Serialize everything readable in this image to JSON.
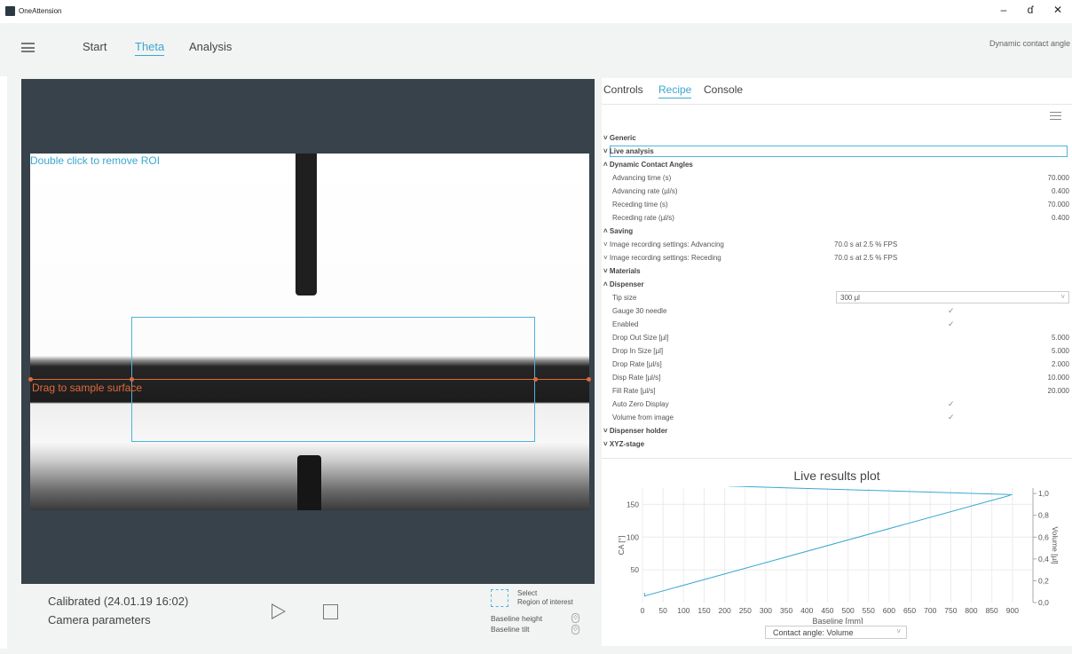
{
  "app": {
    "title": "OneAttension"
  },
  "window_controls": {
    "minimize": "–",
    "maximize": "ɗ",
    "close": "✕"
  },
  "nav": {
    "tabs": [
      "Start",
      "Theta",
      "Analysis"
    ],
    "active": "Theta",
    "mode_label": "Dynamic contact angle"
  },
  "camera": {
    "roi_hint": "Double click to remove ROI",
    "baseline_hint": "Drag to sample surface",
    "calibration": "Calibrated (24.01.19 16:02)",
    "camera_parameters": "Camera parameters",
    "roi_select_line1": "Select",
    "roi_select_line2": "Region of interest",
    "baseline_height": "Baseline height",
    "baseline_tilt": "Baseline tilt"
  },
  "panel": {
    "tabs": [
      "Controls",
      "Recipe",
      "Console"
    ],
    "active": "Recipe",
    "recipe": {
      "generic": "Generic",
      "live_analysis": "Live analysis",
      "dca": "Dynamic Contact Angles",
      "advancing_time_label": "Advancing time (s)",
      "advancing_time": "70.000",
      "advancing_rate_label": "Advancing rate (µl/s)",
      "advancing_rate": "0.400",
      "receding_time_label": "Receding time (s)",
      "receding_time": "70.000",
      "receding_rate_label": "Receding rate (µl/s)",
      "receding_rate": "0.400",
      "saving": "Saving",
      "img_adv_label": "Image recording settings: Advancing",
      "img_adv": "70.0 s at 2.5 % FPS",
      "img_rec_label": "Image recording settings: Receding",
      "img_rec": "70.0 s at 2.5 % FPS",
      "materials": "Materials",
      "dispenser": "Dispenser",
      "tip_size_label": "Tip size",
      "tip_size": "300 µl",
      "gauge_label": "Gauge 30 needle",
      "enabled_label": "Enabled",
      "drop_out_label": "Drop Out Size [µl]",
      "drop_out": "5.000",
      "drop_in_label": "Drop In Size [µl]",
      "drop_in": "5.000",
      "drop_rate_label": "Drop Rate [µl/s]",
      "drop_rate": "2.000",
      "disp_rate_label": "Disp Rate [µl/s]",
      "disp_rate": "10.000",
      "fill_rate_label": "Fill Rate [µl/s]",
      "fill_rate": "20.000",
      "auto_zero_label": "Auto Zero Display",
      "vol_img_label": "Volume from image",
      "disp_holder": "Dispenser holder",
      "xyz": "XYZ-stage"
    }
  },
  "plot": {
    "title": "Live results plot",
    "xlabel": "Baseline [mm]",
    "ylabel_left": "CA [°]",
    "ylabel_right": "Volume [µl]",
    "legend_ca": "— Contact angle",
    "legend_vol": "— Volume",
    "selector": "Contact angle: Volume",
    "x_ticks": [
      "0",
      "50",
      "100",
      "150",
      "200",
      "250",
      "300",
      "350",
      "400",
      "450",
      "500",
      "550",
      "600",
      "650",
      "700",
      "750",
      "800",
      "850",
      "900"
    ],
    "left_ticks": [
      "150",
      "100",
      "50"
    ],
    "right_ticks": [
      "1,0",
      "0,8",
      "0,6",
      "0,4",
      "0,2",
      "0,0"
    ],
    "line_color": "#3aa8d0"
  },
  "chart_data": {
    "type": "line",
    "title": "Live results plot",
    "xlabel": "Baseline [mm]",
    "ylabel": "CA [°]",
    "y2label": "Volume [µl]",
    "xlim": [
      0,
      950
    ],
    "ylim": [
      0,
      175
    ],
    "y2lim": [
      0,
      1.05
    ],
    "series": [
      {
        "name": "Contact angle",
        "axis": "left",
        "x": [
          5,
          5,
          895
        ],
        "y": [
          15,
          10,
          164
        ]
      },
      {
        "name": "Volume",
        "axis": "left",
        "x": [
          210,
          900
        ],
        "y": [
          178,
          165
        ]
      }
    ],
    "legend": "bottom"
  }
}
